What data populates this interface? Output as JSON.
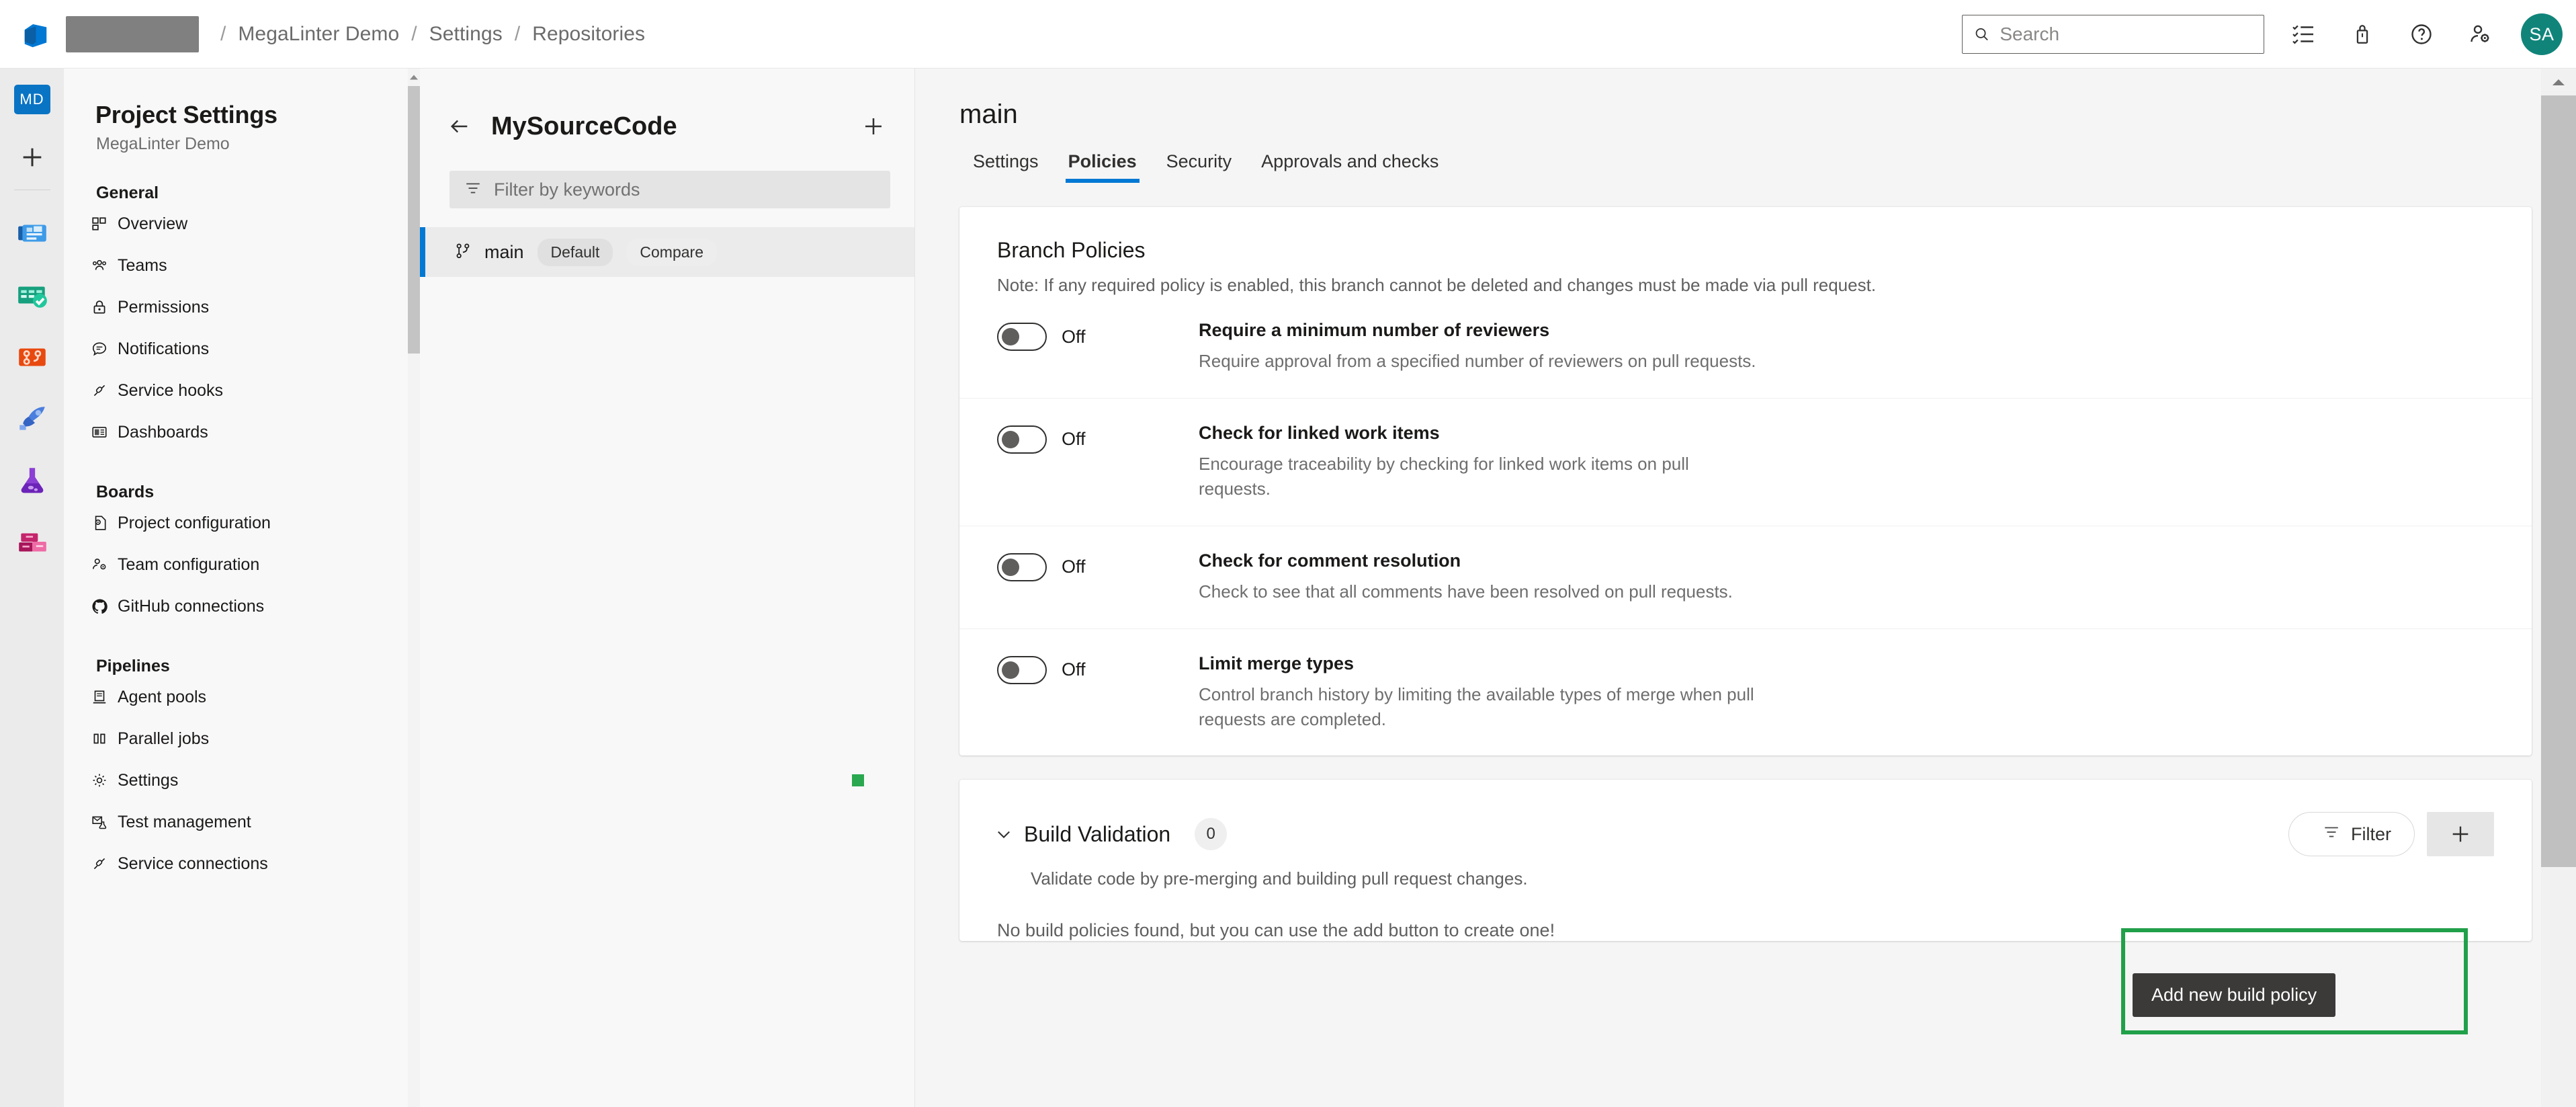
{
  "header": {
    "logo_icon": "azure-devops-logo",
    "org_name_redacted": "",
    "breadcrumbs": [
      "MegaLinter Demo",
      "Settings",
      "Repositories"
    ],
    "separator": "/",
    "search": {
      "placeholder": "Search",
      "value": ""
    },
    "icons": [
      {
        "name": "task-list-icon",
        "glyph": "☰"
      },
      {
        "name": "marketplace-bag-icon",
        "glyph": "▮"
      },
      {
        "name": "help-question-icon",
        "glyph": "?"
      },
      {
        "name": "user-settings-icon",
        "glyph": "⚙"
      }
    ],
    "avatar_initials": "SA",
    "avatar_color": "#11847a"
  },
  "rail": {
    "project_badge": "MD",
    "project_badge_color": "#0a74c4",
    "add_label": "+",
    "items": [
      {
        "name": "overview-hub-icon",
        "label": "Overview"
      },
      {
        "name": "boards-hub-icon",
        "label": "Boards"
      },
      {
        "name": "repos-hub-icon",
        "label": "Repos"
      },
      {
        "name": "pipelines-hub-icon",
        "label": "Pipelines"
      },
      {
        "name": "test-plans-hub-icon",
        "label": "Test Plans"
      },
      {
        "name": "artifacts-hub-icon",
        "label": "Artifacts"
      }
    ]
  },
  "settings_nav": {
    "title": "Project Settings",
    "subtitle": "MegaLinter Demo",
    "groups": [
      {
        "label": "General",
        "items": [
          {
            "label": "Overview",
            "icon": "overview-icon"
          },
          {
            "label": "Teams",
            "icon": "teams-icon"
          },
          {
            "label": "Permissions",
            "icon": "lock-icon"
          },
          {
            "label": "Notifications",
            "icon": "notification-bubble-icon"
          },
          {
            "label": "Service hooks",
            "icon": "service-hooks-icon"
          },
          {
            "label": "Dashboards",
            "icon": "dashboards-icon"
          }
        ]
      },
      {
        "label": "Boards",
        "items": [
          {
            "label": "Project configuration",
            "icon": "project-config-icon"
          },
          {
            "label": "Team configuration",
            "icon": "team-config-icon"
          },
          {
            "label": "GitHub connections",
            "icon": "github-icon"
          }
        ]
      },
      {
        "label": "Pipelines",
        "items": [
          {
            "label": "Agent pools",
            "icon": "agent-pools-icon"
          },
          {
            "label": "Parallel jobs",
            "icon": "parallel-jobs-icon"
          },
          {
            "label": "Settings",
            "icon": "gear-icon"
          },
          {
            "label": "Test management",
            "icon": "test-management-icon"
          },
          {
            "label": "Service connections",
            "icon": "service-connections-icon"
          }
        ]
      }
    ]
  },
  "repo_panel": {
    "back_icon": "back-arrow-icon",
    "repo_name": "MySourceCode",
    "add_icon": "plus-icon",
    "filter": {
      "placeholder": "Filter by keywords",
      "value": "",
      "icon": "filter-icon"
    },
    "branches": [
      {
        "name": "main",
        "icon": "branch-icon",
        "default_badge": "Default",
        "compare_label": "Compare",
        "selected": true
      }
    ]
  },
  "main": {
    "title": "main",
    "tabs": [
      {
        "label": "Settings",
        "active": false
      },
      {
        "label": "Policies",
        "active": true
      },
      {
        "label": "Security",
        "active": false
      },
      {
        "label": "Approvals and checks",
        "active": false
      }
    ],
    "branch_policies": {
      "title": "Branch Policies",
      "note": "Note: If any required policy is enabled, this branch cannot be deleted and changes must be made via pull request.",
      "policies": [
        {
          "state_label": "Off",
          "enabled": false,
          "name": "Require a minimum number of reviewers",
          "description": "Require approval from a specified number of reviewers on pull requests."
        },
        {
          "state_label": "Off",
          "enabled": false,
          "name": "Check for linked work items",
          "description": "Encourage traceability by checking for linked work items on pull requests."
        },
        {
          "state_label": "Off",
          "enabled": false,
          "name": "Check for comment resolution",
          "description": "Check to see that all comments have been resolved on pull requests."
        },
        {
          "state_label": "Off",
          "enabled": false,
          "name": "Limit merge types",
          "description": "Control branch history by limiting the available types of merge when pull requests are completed."
        }
      ]
    },
    "build_validation": {
      "title": "Build Validation",
      "count": "0",
      "chevron_icon": "chevron-down-icon",
      "description": "Validate code by pre-merging and building pull request changes.",
      "empty_message": "No build policies found, but you can use the add button to create one!",
      "filter_button": {
        "label": "Filter",
        "icon": "filter-icon"
      },
      "add_button": {
        "label": "+",
        "icon": "plus-icon"
      },
      "tooltip": "Add new build policy",
      "highlight_color": "#21a04a"
    }
  }
}
